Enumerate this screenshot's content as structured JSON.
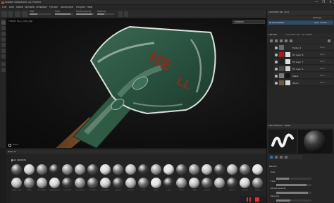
{
  "window": {
    "title": "Adobe Substance 3D Painter",
    "controls": [
      "—",
      "❐",
      "✕"
    ]
  },
  "menu": {
    "items": [
      "File",
      "Edit",
      "Mode",
      "Window",
      "Viewport",
      "Python",
      "JavaScript",
      "Plugins",
      "Help"
    ]
  },
  "toolbar": {
    "size_label": "Size",
    "flow_label": "Flow",
    "stroke_label": "Stroke opacity",
    "spacing_label": "Spacing",
    "size_fill": 0.35,
    "flow_fill": 0.85,
    "stroke_fill": 0.9,
    "spacing_fill": 0.4
  },
  "viewport": {
    "info": "Profile: HLO_GEN_cdp",
    "mode_select": "Material",
    "nav_label": "Hand"
  },
  "shelf": {
    "title": "ASSETS",
    "filter_label": "All libraries",
    "materials_row1": [
      {
        "color": "#5a5a5a"
      },
      {
        "color": "#cfcfcf"
      },
      {
        "color": "#7a7a7a"
      },
      {
        "color": "#2f2f2f"
      },
      {
        "color": "#8d8d8d"
      },
      {
        "color": "#a0a0a0"
      },
      {
        "color": "#4b4b4b"
      },
      {
        "color": "#d6d6d6"
      },
      {
        "color": "#6f6f6f"
      },
      {
        "color": "#bdbdbd"
      },
      {
        "color": "#3a3a3a"
      },
      {
        "color": "#9a9a9a"
      },
      {
        "color": "#e0e0e0"
      },
      {
        "color": "#505050"
      },
      {
        "color": "#858585"
      },
      {
        "color": "#c3c3c3"
      },
      {
        "color": "#444444"
      },
      {
        "color": "#b0b0b0"
      },
      {
        "color": "#6a6a6a"
      },
      {
        "color": "#dddddd"
      }
    ],
    "materials_row2": [
      {
        "color": "#bdbdbd",
        "label": "Paper Tisp"
      },
      {
        "color": "#7f7f7f",
        "label": "Paper"
      },
      {
        "color": "#a8a8a8",
        "label": "Cardboard"
      },
      {
        "color": "#d7d7d7",
        "label": "Cobblestone"
      },
      {
        "color": "#3d3d3d",
        "label": "Concrete"
      },
      {
        "color": "#909090",
        "label": "Crumpled"
      },
      {
        "color": "#5e5e5e",
        "label": "Cracked"
      },
      {
        "color": "#cccccc",
        "label": "Crossed"
      },
      {
        "color": "#474747",
        "label": "Curtain"
      },
      {
        "color": "#b5b5b5",
        "label": "Denim"
      },
      {
        "color": "#6a6a6a",
        "label": "Dirt"
      },
      {
        "color": "#e2e2e2",
        "label": "Dust"
      },
      {
        "color": "#343434",
        "label": "Earth"
      },
      {
        "color": "#8f8f8f",
        "label": "Fabric"
      },
      {
        "color": "#c0c0c0",
        "label": "Fiber"
      },
      {
        "color": "#585858",
        "label": "Gravel"
      },
      {
        "color": "#a3a3a3",
        "label": "Grid"
      },
      {
        "color": "#3f3f3f",
        "label": "Leather"
      },
      {
        "color": "#d2d2d2",
        "label": "Marble"
      },
      {
        "color": "#777777",
        "label": "Metal"
      }
    ]
  },
  "right": {
    "texture_set_list_title": "TEXTURE SET LIST",
    "settings_label": "Settings",
    "texture_set_name": "ID Sandbox01",
    "shader_label": "Main shader",
    "layers_tab": "LAYERS",
    "settings_tab": "TEXTURE SET SETTINGS",
    "layers": [
      {
        "name": "Folder 2",
        "blend": "Norm",
        "thumb": "#6b6b6b",
        "mask": "#2b2b2b"
      },
      {
        "name": "Fill layer 6",
        "blend": "Norm",
        "thumb": "#b01818",
        "mask": "#dcdcdc"
      },
      {
        "name": "Fill layer 7",
        "blend": "Norm",
        "thumb": "#202020",
        "mask": "#e0e0e0"
      },
      {
        "name": "Fill layer 9",
        "blend": "Norm",
        "thumb": "#4a4a4a",
        "mask": "#cfcfcf"
      },
      {
        "name": "Metal",
        "blend": "Norm",
        "thumb": "#7a7a7a",
        "mask": "#141414"
      },
      {
        "name": "Wood",
        "blend": "Norm",
        "thumb": "#6e5a3c",
        "mask": "#d8d8d8"
      }
    ],
    "properties_title": "PROPERTIES - PAINT",
    "brush_section": "BRUSH",
    "size_label": "Size",
    "flow_label": "Flow",
    "stroke_opacity_label": "Stroke opacity",
    "spacing_label": "Spacing",
    "size_fill": 0.35,
    "flow_fill": 0.85,
    "stroke_fill": 0.9,
    "spacing_fill": 0.4
  },
  "colors": {
    "accent": "#2f6fb0",
    "record": "#e03030",
    "shovel_green": "#2f5a44",
    "rust_red": "#8f2a1d"
  }
}
